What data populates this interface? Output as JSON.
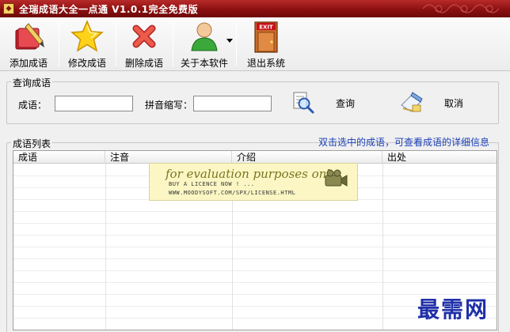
{
  "window": {
    "title": "全瑞成语大全一点通 V1.0.1完全免费版",
    "titlebar_color": "#8c1010"
  },
  "toolbar": {
    "items": [
      {
        "label": "添加成语",
        "icon": "add-book-icon"
      },
      {
        "label": "修改成语",
        "icon": "star-icon"
      },
      {
        "label": "删除成语",
        "icon": "delete-x-icon"
      },
      {
        "label": "关于本软件",
        "icon": "user-icon"
      },
      {
        "label": "退出系统",
        "icon": "exit-door-icon"
      }
    ],
    "exit_sign": "EXIT"
  },
  "query": {
    "legend": "查询成语",
    "idiom_label": "成语：",
    "idiom_value": "",
    "pinyin_label": "拼音缩写：",
    "pinyin_value": "",
    "search_label": "查询",
    "cancel_label": "取消"
  },
  "list": {
    "legend": "成语列表",
    "hint": "双击选中的成语，可查看成语的详细信息",
    "hint_color": "#1a3fb8",
    "columns": [
      "成语",
      "注音",
      "介绍",
      "出处"
    ],
    "rows": []
  },
  "eval_banner": {
    "line1": "for evaluation purposes only.",
    "line2": "BUY A LICENCE NOW ! ...",
    "line3": "WWW.MOODYSOFT.COM/SPX/LICENSE.HTML"
  },
  "site_logo": "最需网"
}
